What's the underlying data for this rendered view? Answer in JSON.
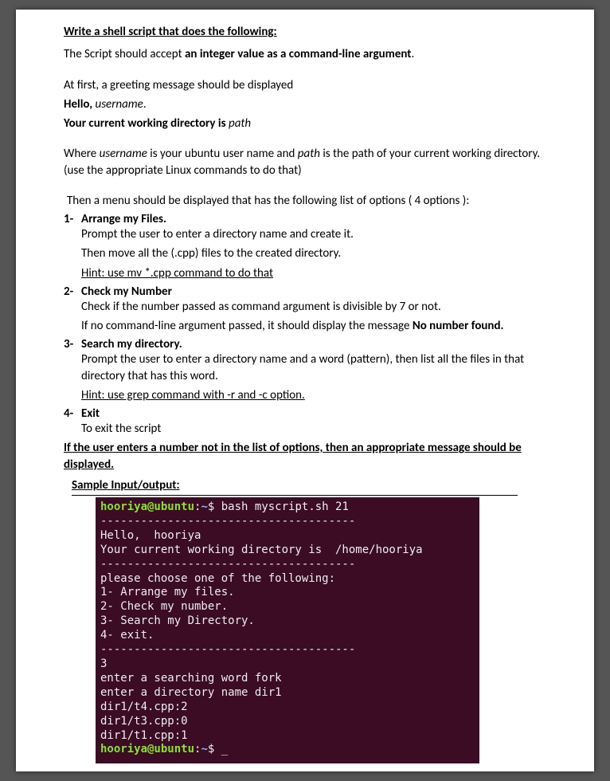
{
  "title": "Write a shell script that does the following:",
  "intro": {
    "line1a": "The Script should accept ",
    "line1b": "an integer value as a command-line argument",
    "line1c": "."
  },
  "greet": {
    "l1": "At first, a greeting message should be displayed",
    "l2a": "Hello, ",
    "l2b": "username",
    "l2c": ".",
    "l3a": "Your current working directory is ",
    "l3b": "path"
  },
  "where": {
    "a": "Where ",
    "u": "username",
    "b": " is your ubuntu user name and ",
    "p": "path",
    "c": " is the path of your current working directory. (use the appropriate Linux commands to do that)"
  },
  "menu_intro": "Then a menu should be displayed that has the following list of options ( 4 options ):",
  "opt1": {
    "num": "1-",
    "title": "Arrange my Files.",
    "l1": "Prompt the user to enter a directory name and create it.",
    "l2": "Then move all the (.cpp) files to the created directory.",
    "hint": "Hint: use mv  *.cpp  command to do that"
  },
  "opt2": {
    "num": "2-",
    "title": "Check my Number",
    "l1": "Check if the number passed as command argument is divisible by 7 or not.",
    "l2a": "If no command-line argument passed, it should display the message ",
    "l2b": "No number found."
  },
  "opt3": {
    "num": "3-",
    "title": "Search my directory.",
    "l1": "Prompt the user to enter a directory name and a word (pattern), then list all the files in that directory that has this word.",
    "hint": "Hint: use grep command with -r and -c option."
  },
  "opt4": {
    "num": "4-",
    "title": "Exit",
    "l1": "To exit the script"
  },
  "final": "If the user enters a number not in the list of options, then an appropriate message should be displayed.",
  "sample_hdr": "Sample Input/output:",
  "term": {
    "prompt_user": "hooriya@ubuntu",
    "prompt_sep": ":",
    "prompt_path": "~",
    "prompt_dollar": "$ ",
    "cmd": "bash myscript.sh 21",
    "dash1": "--------------------------------------",
    "hello": "Hello,  hooriya",
    "cwd": "Your current working directory is  /home/hooriya",
    "dash2": "--------------------------------------",
    "menu0": "please choose one of the following:",
    "menu1": "1- Arrange my files.",
    "menu2": "2- Check my number.",
    "menu3": "3- Search my Directory.",
    "menu4": "4- exit.",
    "dash3": "--------------------------------------",
    "in3": "3",
    "inw": "enter a searching word fork",
    "ind": "enter a directory name dir1",
    "r1": "dir1/t4.cpp:2",
    "r2": "dir1/t3.cpp:0",
    "r3": "dir1/t1.cpp:1",
    "cursor": "_"
  }
}
